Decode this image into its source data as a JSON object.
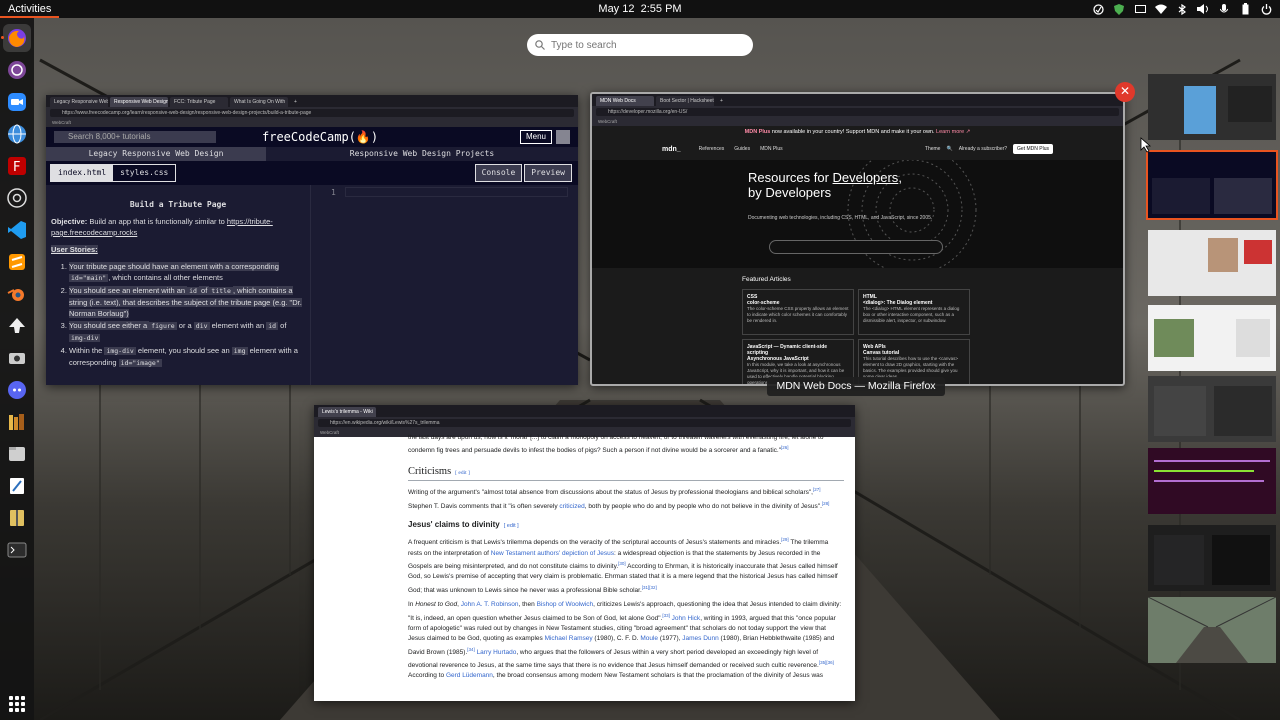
{
  "topbar": {
    "activities": "Activities",
    "date": "May 12",
    "time": "2:55 PM"
  },
  "dock": {
    "apps": [
      "firefox-icon",
      "tor-browser-icon",
      "zoom-icon",
      "network-globe-icon",
      "filezilla-icon",
      "chrome-icon",
      "vscode-icon",
      "sublime-icon",
      "blender-icon",
      "inkscape-icon",
      "screenshot-icon",
      "discord-icon",
      "library-icon",
      "files-icon",
      "text-editor-icon",
      "archive-manager-icon",
      "terminal-icon"
    ]
  },
  "search": {
    "placeholder": "Type to search"
  },
  "fcc_window": {
    "tabs": [
      "Legacy Responsive Web",
      "Responsive Web Design",
      "FCC: Tribute Page",
      "What Is Going On With",
      "+"
    ],
    "url": "https://www.freecodecamp.org/learn/responsive-web-design/responsive-web-design-projects/build-a-tribute-page",
    "bookmark": "WebCraft",
    "search_placeholder": "Search 8,000+ tutorials",
    "logo": "freeCodeCamp(🔥)",
    "menu": "Menu",
    "crumb_1": "Legacy Responsive Web Design",
    "crumb_2": "Responsive Web Design Projects",
    "file_1": "index.html",
    "file_2": "styles.css",
    "console": "Console",
    "preview": "Preview",
    "title": "Build a Tribute Page",
    "objective_label": "Objective:",
    "objective_text": " Build an app that is functionally similar to ",
    "objective_link": "https://tribute-page.freecodecamp.rocks",
    "stories_label": "User Stories:",
    "stories": [
      {
        "a": "Your tribute page should have an element with a corresponding ",
        "code": "id=\"main\"",
        "b": ", which contains all other elements"
      },
      {
        "a": "You should see an element with an ",
        "code": "id",
        "b": " of ",
        "code2": "title",
        "c": ", which contains a string (i.e. text), that describes the subject of the tribute page (e.g. \"Dr. Norman Borlaug\")"
      },
      {
        "a": "You should see either a ",
        "code": "figure",
        "b": " or a ",
        "code2": "div",
        "c": " element with an ",
        "code3": "id",
        "d": " of ",
        "code4": "img-div"
      },
      {
        "a": "Within the ",
        "code": "img-div",
        "b": " element, you should see an ",
        "code2": "img",
        "c": " element with a corresponding ",
        "code3": "id=\"image\""
      }
    ],
    "line_number": "1"
  },
  "mdn_window": {
    "tabs": [
      "MDN Web Docs",
      "Boot Sector | Hacksheet",
      "+"
    ],
    "url": "https://developer.mozilla.org/en-US/",
    "bookmark": "WebCraft",
    "banner_brand": "MDN Plus",
    "banner_text": " now available in your country! Support MDN and make it your own. ",
    "banner_link": "Learn more ↗",
    "nav_logo": "mdn_",
    "nav": [
      "References",
      "Guides",
      "MDN Plus"
    ],
    "theme": "Theme",
    "already": "Already a subscriber?",
    "get_plus": "Get MDN Plus",
    "hero_line_1": "Resources for ",
    "hero_highlight": "Developers",
    "hero_line_1_end": ",",
    "hero_line_2": "by Developers",
    "hero_sub": "Documenting web technologies, including CSS, HTML, and JavaScript, since 2005.",
    "featured_title": "Featured Articles",
    "cards": [
      {
        "tag": "CSS",
        "title": "color-scheme",
        "text": "The color-scheme CSS property allows an element to indicate which color schemes it can comfortably be rendered in."
      },
      {
        "tag": "HTML",
        "title": "<dialog>: The Dialog element",
        "text": "The <dialog> HTML element represents a dialog box or other interactive component, such as a dismissible alert, inspector, or subwindow."
      },
      {
        "tag": "JavaScript — Dynamic client-side scripting",
        "title": "Asynchronous JavaScript",
        "text": "In this module, we take a look at asynchronous JavaScript, why it is important, and how it can be used to effectively handle potential blocking operations."
      },
      {
        "tag": "Web APIs",
        "title": "Canvas tutorial",
        "text": "This tutorial describes how to use the <canvas> element to draw 2D graphics, starting with the basics. The examples provided should give you some clear ideas."
      }
    ],
    "caption": "MDN Web Docs — Mozilla Firefox"
  },
  "wiki_window": {
    "tab": "Lewis's trilemma - Wiki",
    "url": "https://en.wikipedia.org/wiki/Lewis%27s_trilemma",
    "bookmark": "WebCraft",
    "p0": "the last days are upon us, how is it 'moral' [...] to claim a monopoly on access to heaven, or to threaten waverers with everlasting fire, let alone to condemn fig trees and persuade devils to infest the bodies of pigs? Such a person if not divine would be a sorcerer and a fanatic.\"",
    "p0_ref": "[26]",
    "h_criticisms": "Criticisms",
    "edit": "[ edit ]",
    "p1": "Writing of the argument's \"almost total absence from discussions about the status of Jesus by professional theologians and biblical scholars\",",
    "p1_ref": "[27]",
    "p1b": " Stephen T. Davis comments that it \"is often severely ",
    "p1_link": "criticized",
    "p1c": ", both by people who do and by people who do not believe in the divinity of Jesus\".",
    "p1_ref2": "[28]",
    "h_divinity": "Jesus' claims to divinity",
    "p2": "A frequent criticism is that Lewis's trilemma depends on the veracity of the scriptural accounts of Jesus's statements and miracles.",
    "p2_ref": "[29]",
    "p2b": " The trilemma rests on the interpretation of ",
    "p2_link": "New Testament authors' depiction of Jesus",
    "p2c": ": a widespread objection is that the statements by Jesus recorded in the Gospels are being misinterpreted, and do not constitute claims to divinity.",
    "p2_ref2": "[30]",
    "p2d": " According to Ehrman, it is historically inaccurate that Jesus called himself God, so Lewis's premise of accepting that very claim is problematic. Ehrman stated that it is a mere legend that the historical Jesus has called himself God; that was unknown to Lewis since he never was a professional Bible scholar.",
    "p2_ref3": "[31][32]",
    "p3_in": "In ",
    "p3_book": "Honest to God",
    "p3_a": ", ",
    "p3_link1": "John A. T. Robinson",
    "p3_b": ", then ",
    "p3_link2": "Bishop of Woolwich",
    "p3_c": ", criticizes Lewis's approach, questioning the idea that Jesus intended to claim divinity: \"It is, indeed, an open question whether Jesus claimed to be Son of God, let alone God\".",
    "p3_ref": "[33]",
    "p3_link3": " John Hick",
    "p3_d": ", writing in 1993, argued that this \"once popular form of apologetic\" was ruled out by changes in New Testament studies, citing \"broad agreement\" that scholars do not today support the view that Jesus claimed to be God, quoting as examples ",
    "p3_link4": "Michael Ramsey",
    "p3_e": " (1980), C. F. D. ",
    "p3_link5": "Moule",
    "p3_f": " (1977), ",
    "p3_link6": "James Dunn",
    "p3_g": " (1980), Brian Hebblethwaite (1985) and David Brown (1985).",
    "p3_ref2": "[34]",
    "p3_link7": " Larry Hurtado",
    "p3_h": ", who argues that the followers of Jesus within a very short period developed an exceedingly high level of devotional reverence to Jesus, at the same time says that there is no evidence that Jesus himself demanded or received such cultic reverence.",
    "p3_ref3": "[35][36]",
    "p3_i": " According to ",
    "p3_link8": "Gerd Lüdemann",
    "p3_j": ", the broad consensus among modern New Testament scholars is that the proclamation of the divinity of Jesus was"
  },
  "workspaces": {
    "count": 8,
    "selected": 2
  },
  "colors": {
    "accent": "#e95420",
    "fcc_bg": "#0a0a23",
    "mdn_close": "#e0392b",
    "wiki_link": "#3366cc"
  }
}
